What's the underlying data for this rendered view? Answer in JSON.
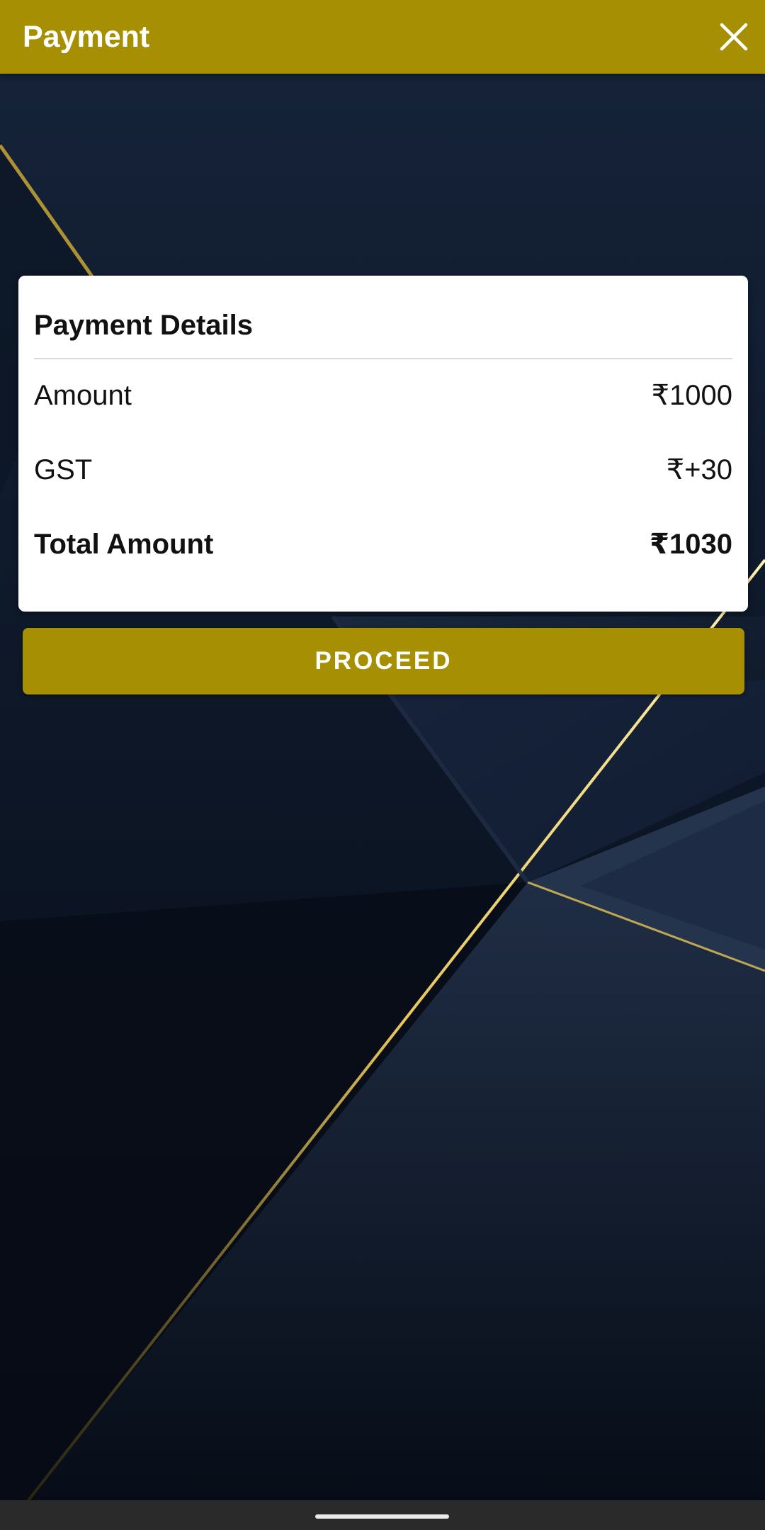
{
  "app_bar": {
    "title": "Payment",
    "close_icon": "close-icon"
  },
  "payment_card": {
    "title": "Payment Details",
    "rows": [
      {
        "label": "Amount",
        "value": "₹1000"
      },
      {
        "label": "GST",
        "value": "₹+30"
      },
      {
        "label": "Total Amount",
        "value": "₹1030"
      }
    ]
  },
  "actions": {
    "proceed_label": "PROCEED"
  },
  "colors": {
    "brand": "#a68f02",
    "background": "#0b1220",
    "card": "#ffffff",
    "gold_line": "#d4b23a"
  }
}
